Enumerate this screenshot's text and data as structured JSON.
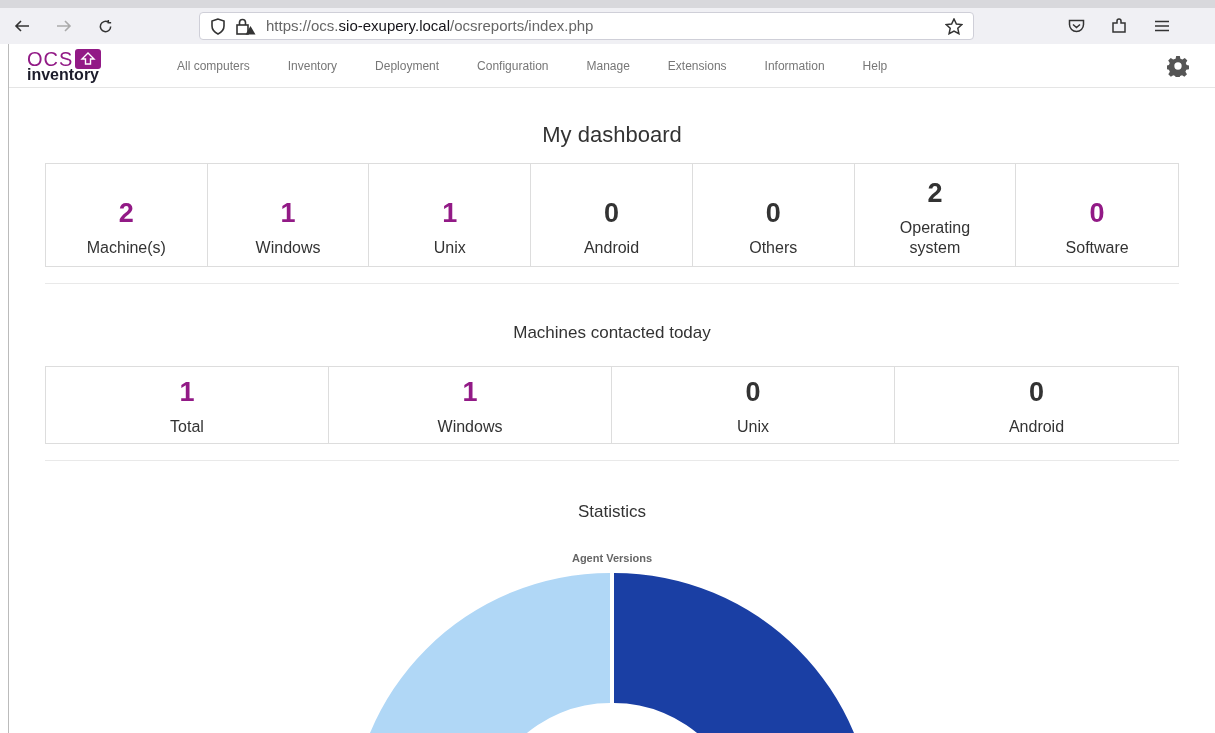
{
  "browser": {
    "url_parts": [
      {
        "text": "https://ocs.",
        "emphasis": false
      },
      {
        "text": "sio-exupery.local",
        "emphasis": true
      },
      {
        "text": "/ocsreports/index.php",
        "emphasis": false
      }
    ]
  },
  "app": {
    "logo_top": "OCS",
    "logo_bottom": "inventory",
    "nav": [
      "All computers",
      "Inventory",
      "Deployment",
      "Configuration",
      "Manage",
      "Extensions",
      "Information",
      "Help"
    ]
  },
  "dashboard": {
    "title": "My dashboard",
    "stats": [
      {
        "value": "2",
        "label": "Machine(s)",
        "color": "#921a86"
      },
      {
        "value": "1",
        "label": "Windows",
        "color": "#921a86"
      },
      {
        "value": "1",
        "label": "Unix",
        "color": "#921a86"
      },
      {
        "value": "0",
        "label": "Android",
        "color": "#333333"
      },
      {
        "value": "0",
        "label": "Others",
        "color": "#333333"
      },
      {
        "value": "2",
        "label": "Operating system",
        "color": "#333333"
      },
      {
        "value": "0",
        "label": "Software",
        "color": "#921a86"
      }
    ],
    "contacted_title": "Machines contacted today",
    "contacted": [
      {
        "value": "1",
        "label": "Total",
        "color": "#921a86"
      },
      {
        "value": "1",
        "label": "Windows",
        "color": "#921a86"
      },
      {
        "value": "0",
        "label": "Unix",
        "color": "#333333"
      },
      {
        "value": "0",
        "label": "Android",
        "color": "#333333"
      }
    ],
    "statistics_title": "Statistics",
    "chart_title": "Agent Versions"
  }
}
